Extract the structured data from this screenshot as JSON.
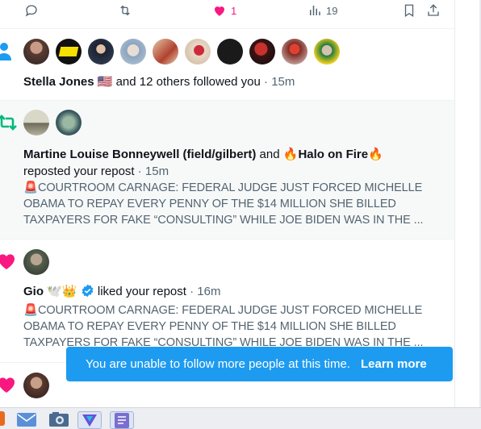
{
  "tweet_actions": {
    "like_count": "1",
    "views_count": "19"
  },
  "notifications": [
    {
      "type": "follow",
      "actor": "Stella Jones",
      "flag": "🇺🇸",
      "rest": "and 12 others followed you",
      "time": "· 15m"
    },
    {
      "type": "repost",
      "actor1": "Martine Louise Bonneywell (field/gilbert)",
      "conj": "and",
      "actor2_prefix": "🔥",
      "actor2": "Halo on Fire",
      "actor2_suffix": "🔥",
      "action": "reposted your repost",
      "time": "· 15m",
      "post_text": "🚨COURTROOM CARNAGE: FEDERAL JUDGE JUST FORCED MICHELLE OBAMA TO REPAY EVERY PENNY OF THE $14 MILLION SHE BILLED TAXPAYERS FOR FAKE “CONSULTING” WHILE JOE BIDEN WAS IN THE ..."
    },
    {
      "type": "like",
      "actor": "Gio",
      "actor_suffix": "🕊️👑",
      "action": "liked your repost",
      "time": "· 16m",
      "post_text": "🚨COURTROOM CARNAGE: FEDERAL JUDGE JUST FORCED MICHELLE OBAMA TO REPAY EVERY PENNY OF THE $14 MILLION SHE BILLED TAXPAYERS FOR FAKE “CONSULTING” WHILE JOE BIDEN WAS IN THE ..."
    }
  ],
  "toast": {
    "message": "You are unable to follow more people at this time.",
    "link": "Learn more"
  },
  "colors": {
    "accent": "#1d9bf0",
    "like": "#f91880",
    "repost": "#00ba7c",
    "muted": "#536471"
  }
}
